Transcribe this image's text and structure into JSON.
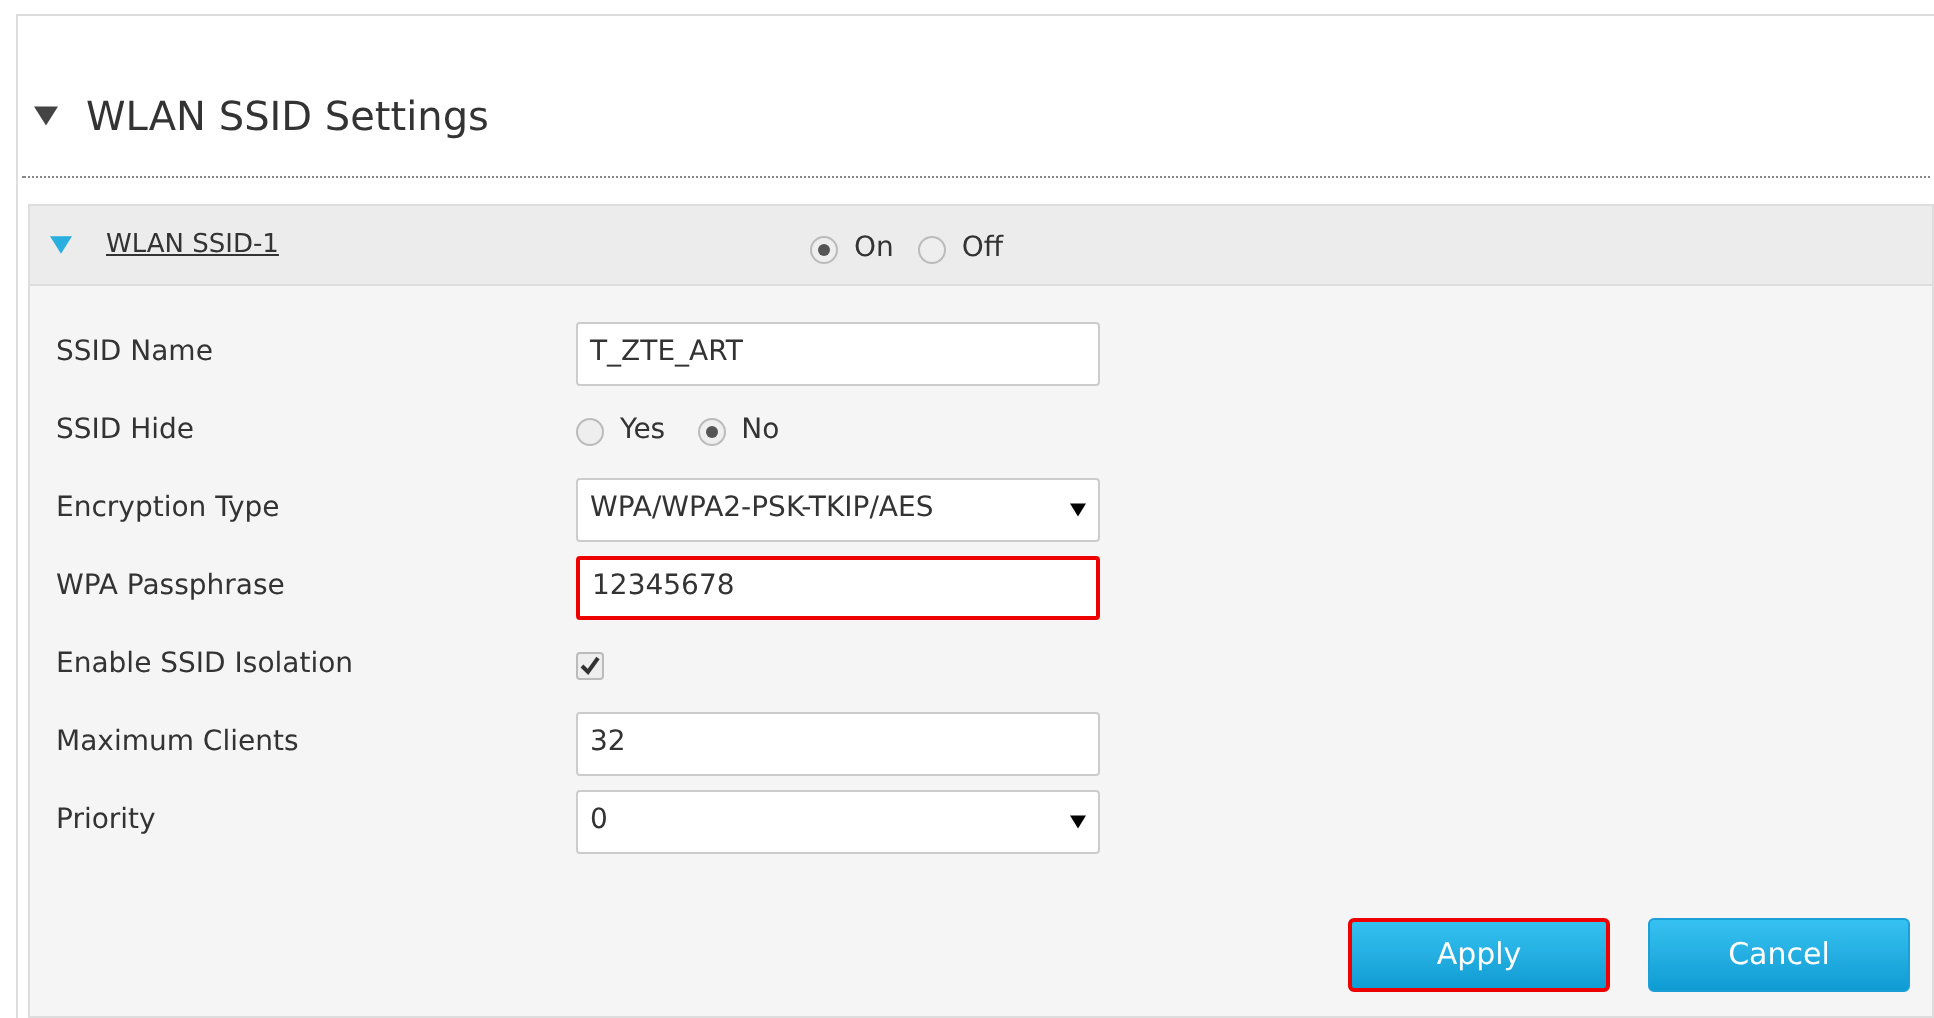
{
  "section": {
    "title": "WLAN SSID Settings",
    "expanded": true
  },
  "panel": {
    "title": "WLAN SSID-1",
    "expanded": true,
    "options": [
      {
        "label": "On",
        "selected": true
      },
      {
        "label": "Off",
        "selected": false
      }
    ]
  },
  "fields": [
    {
      "kind": "text",
      "label": "SSID Name",
      "value": "T_ZTE_ART",
      "highlighted": false
    },
    {
      "kind": "radio",
      "label": "SSID Hide",
      "options": [
        {
          "label": "Yes",
          "selected": false
        },
        {
          "label": "No",
          "selected": true
        }
      ]
    },
    {
      "kind": "select",
      "label": "Encryption Type",
      "value": "WPA/WPA2-PSK-TKIP/AES",
      "highlighted": false
    },
    {
      "kind": "text",
      "label": "WPA Passphrase",
      "value": "12345678",
      "highlighted": true
    },
    {
      "kind": "checkbox",
      "label": "Enable SSID Isolation",
      "checked": true
    },
    {
      "kind": "text",
      "label": "Maximum Clients",
      "value": "32",
      "highlighted": false
    },
    {
      "kind": "select",
      "label": "Priority",
      "value": "0",
      "highlighted": false
    }
  ],
  "buttons": [
    {
      "label": "Apply",
      "highlighted": true
    },
    {
      "label": "Cancel",
      "highlighted": false
    }
  ]
}
